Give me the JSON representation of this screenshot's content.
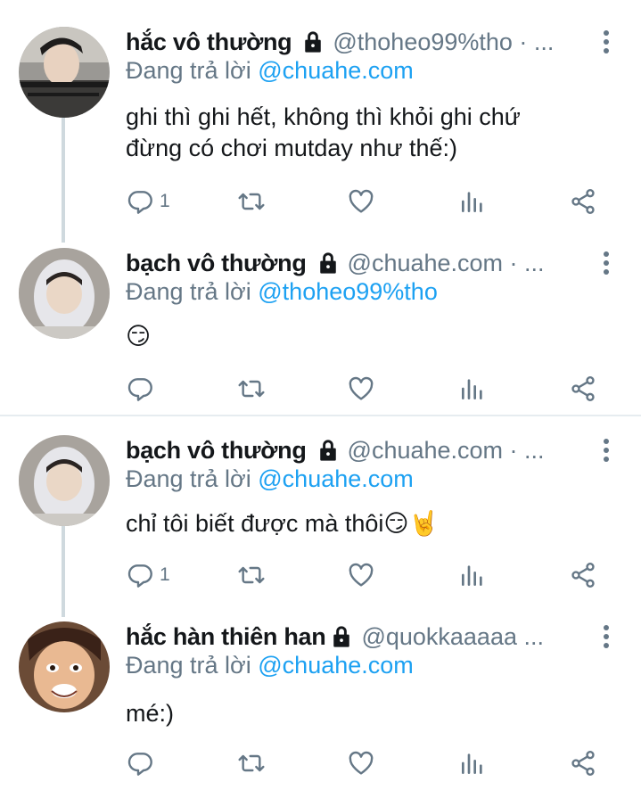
{
  "tweets": [
    {
      "name": "hắc vô thường",
      "handle": "@thoheo99%tho · ...",
      "replying_prefix": "Đang trả lời ",
      "replying_to": "@chuahe.com",
      "text_lines": [
        "ghi thì ghi hết, không thì khỏi ghi chứ",
        "đừng có chơi mutday như thế:)"
      ],
      "reply_count": "1"
    },
    {
      "name": "bạch vô thường",
      "handle": "@chuahe.com · ...",
      "replying_prefix": "Đang trả lời ",
      "replying_to": "@thoheo99%tho",
      "text_lines": [
        "😏"
      ],
      "reply_count": ""
    },
    {
      "name": "bạch vô thường",
      "handle": "@chuahe.com · ...",
      "replying_prefix": "Đang trả lời ",
      "replying_to": "@chuahe.com",
      "text_lines": [
        "chỉ tôi biết được mà thôi😏🤘"
      ],
      "reply_count": "1"
    },
    {
      "name": "hắc hàn thiên han",
      "handle": "@quokkaaaaa ...",
      "replying_prefix": "Đang trả lời ",
      "replying_to": "@chuahe.com",
      "text_lines": [
        "mé:)"
      ],
      "reply_count": ""
    }
  ],
  "colors": {
    "accent": "#1da1f2",
    "muted": "#657786",
    "thread_line": "#cfd9de"
  }
}
